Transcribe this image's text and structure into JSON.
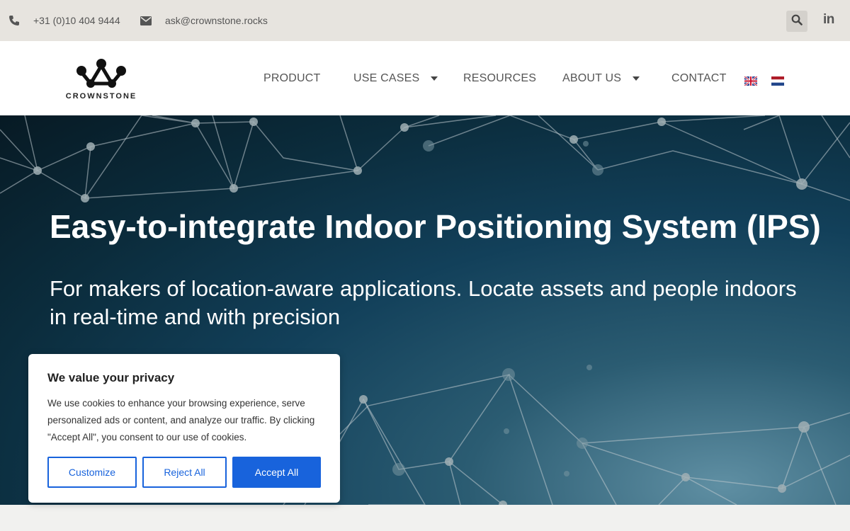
{
  "topbar": {
    "phone": "+31 (0)10 404 9444",
    "email": "ask@crownstone.rocks",
    "linkedin_label": "in"
  },
  "header": {
    "logo_text": "CROWNSTONE",
    "nav": [
      {
        "label": "PRODUCT"
      },
      {
        "label": "USE CASES"
      },
      {
        "label": "RESOURCES"
      },
      {
        "label": "ABOUT US"
      },
      {
        "label": "CONTACT"
      }
    ]
  },
  "hero": {
    "title": "Easy-to-integrate Indoor Positioning System (IPS)",
    "subtitle": "For makers of location-aware applications. Locate assets and people indoors in real-time and with precision"
  },
  "privacy": {
    "title": "We value your privacy",
    "text": "We use cookies to enhance your browsing experience, serve personalized ads or content, and analyze our traffic. By clicking \"Accept All\", you consent to our use of cookies.",
    "customize": "Customize",
    "reject": "Reject All",
    "accept": "Accept All"
  },
  "colors": {
    "accent": "#1863dc",
    "topbar_bg": "#e7e4df",
    "hero_dark": "#071a24"
  },
  "icons": [
    "phone-icon",
    "envelope-icon",
    "search-icon",
    "linkedin-icon",
    "crownstone-logo",
    "uk-flag-icon",
    "nl-flag-icon"
  ]
}
